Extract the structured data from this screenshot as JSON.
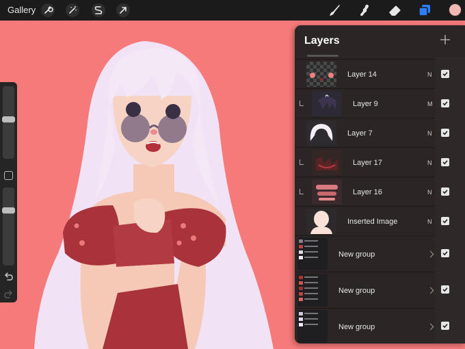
{
  "toolbar": {
    "gallery_label": "Gallery",
    "left_tools": [
      "wrench-icon",
      "magic-wand-icon",
      "selection-icon",
      "transform-arrow-icon"
    ],
    "right_tools": [
      "brush-icon",
      "smudge-icon",
      "eraser-icon",
      "layers-icon"
    ],
    "active_color": "#f2b8b3",
    "active_tool_color": "#2d7ff9"
  },
  "canvas": {
    "background": "#f57a79"
  },
  "sidebar": {
    "brush_size_level": 0.55,
    "opacity_level": 0.72,
    "undo": "undo-icon",
    "redo": "redo-icon"
  },
  "layers_panel": {
    "title": "Layers",
    "add_button": "+",
    "layers": [
      {
        "name": "Layer 14",
        "blend": "N",
        "visible": true,
        "clipped": false
      },
      {
        "name": "Layer 9",
        "blend": "M",
        "visible": true,
        "clipped": true
      },
      {
        "name": "Layer 7",
        "blend": "N",
        "visible": true,
        "clipped": false
      },
      {
        "name": "Layer 17",
        "blend": "N",
        "visible": true,
        "clipped": true
      },
      {
        "name": "Layer 16",
        "blend": "N",
        "visible": true,
        "clipped": true
      },
      {
        "name": "Inserted Image",
        "blend": "N",
        "visible": true,
        "clipped": false
      }
    ],
    "groups": [
      {
        "name": "New group",
        "visible": true
      },
      {
        "name": "New group",
        "visible": true
      },
      {
        "name": "New group",
        "visible": true
      }
    ]
  }
}
